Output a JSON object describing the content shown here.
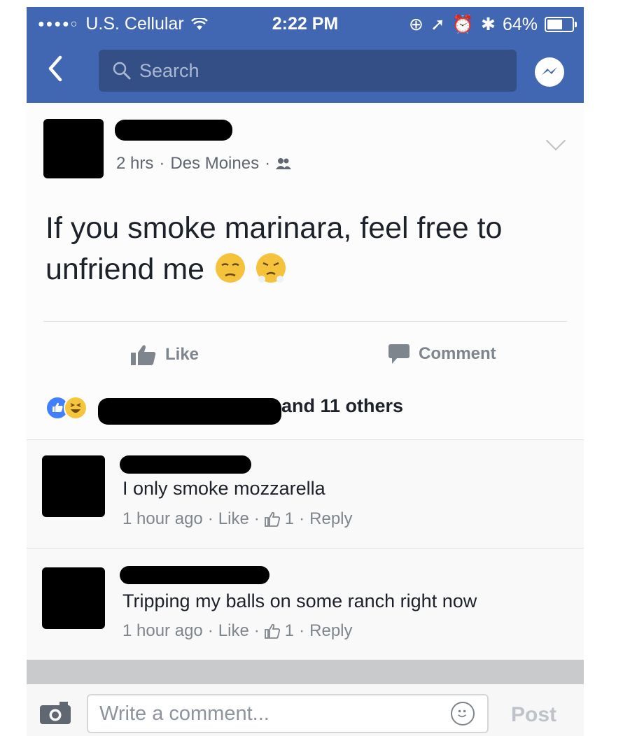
{
  "status_bar": {
    "carrier": "U.S. Cellular",
    "time": "2:22 PM",
    "battery": "64%",
    "battery_level": 0.64
  },
  "nav": {
    "search_placeholder": "Search",
    "back_icon": "chevron-left-icon",
    "messenger_icon": "messenger-icon"
  },
  "post": {
    "time": "2 hrs",
    "location": "Des Moines",
    "separator": "·",
    "audience_icon": "friends-icon",
    "text": "If you smoke marinara, feel free to unfriend me",
    "emojis": [
      "unamused-face",
      "steam-from-nose-face"
    ],
    "like_label": "Like",
    "comment_label": "Comment"
  },
  "reactions": {
    "summary": "and 11 others",
    "types": [
      "like",
      "haha"
    ]
  },
  "comments": [
    {
      "text": "I only smoke mozzarella",
      "time": "1 hour ago",
      "like_label": "Like",
      "like_count": "1",
      "reply_label": "Reply"
    },
    {
      "text": "Tripping my balls on some ranch right now",
      "time": "1 hour ago",
      "like_label": "Like",
      "like_count": "1",
      "reply_label": "Reply"
    }
  ],
  "composer": {
    "placeholder": "Write a comment...",
    "post_label": "Post"
  },
  "colors": {
    "brand": "#4267b2",
    "search_bg": "#344e86",
    "like_blue": "#4080ff",
    "muted": "#7f858d"
  }
}
